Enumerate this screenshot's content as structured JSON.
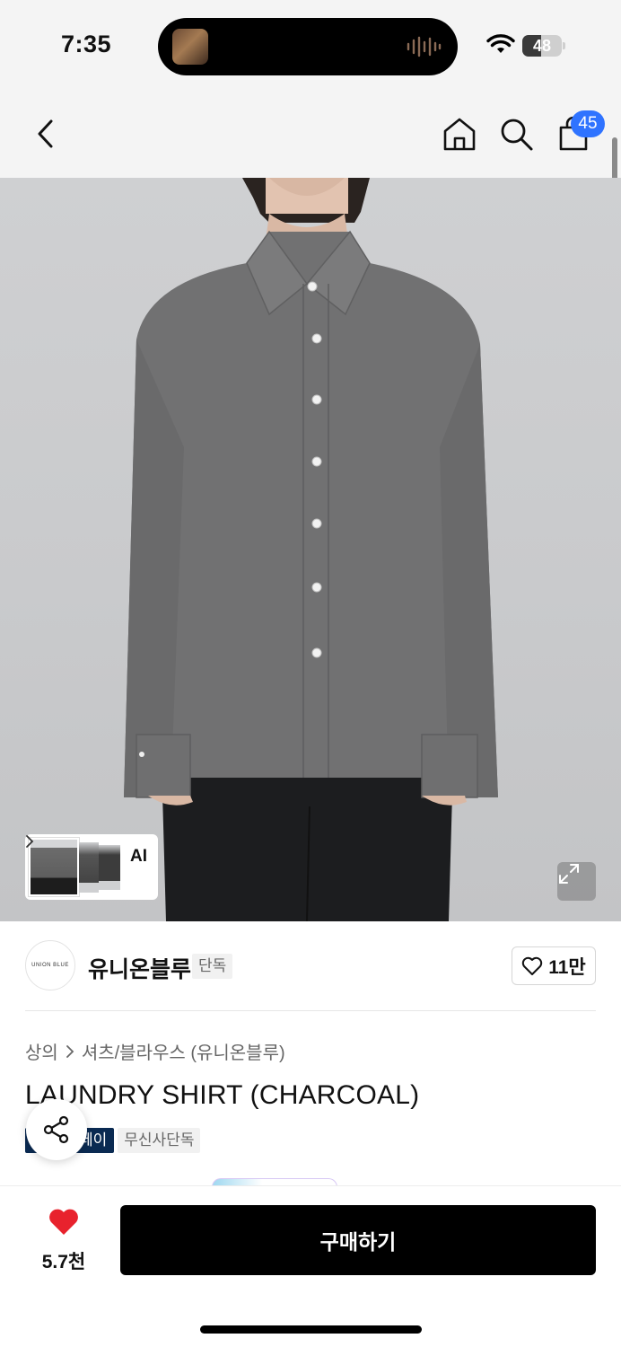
{
  "status_bar": {
    "time": "7:35",
    "battery_level": "48",
    "battery_fraction": 0.48,
    "wifi_icon": "wifi-icon",
    "island_icons": [
      "album-art-thumbnail",
      "audio-waveform-icon"
    ]
  },
  "header": {
    "back_icon": "chevron-left-icon",
    "home_icon": "home-icon",
    "search_icon": "search-icon",
    "cart_icon": "shopping-bag-icon",
    "cart_count": "45",
    "badge_color": "#2f73ff"
  },
  "hero": {
    "thumbnail_strip_label": "AI",
    "expand_icon": "expand-icon"
  },
  "brand": {
    "logo_text": "UNION BLUE",
    "name": "유니온블루",
    "tag": "단독",
    "like_count": "11만"
  },
  "product": {
    "breadcrumb": [
      "상의",
      "셔츠/블라우스 (유니온블루)"
    ],
    "title": "LAUNDRY SHIRT (CHARCOAL)",
    "badges": [
      "페이",
      "무신사단독"
    ],
    "pay_badge_color": "#0a2a52"
  },
  "bottom_bar": {
    "wish_count": "5.7천",
    "heart_color": "#e8222d",
    "buy_label": "구매하기"
  }
}
